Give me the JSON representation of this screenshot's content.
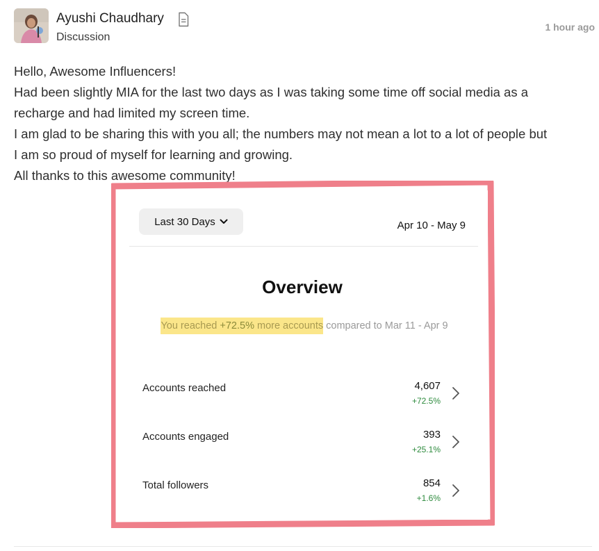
{
  "post": {
    "author": "Ayushi Chaudhary",
    "category": "Discussion",
    "timestamp": "1 hour ago",
    "body_lines": [
      "Hello, Awesome Influencers!",
      "Had been slightly MIA for the last two days as I was taking some time off social media as a",
      "recharge and had limited my screen time.",
      "I am glad to be sharing this with you all; the numbers may not mean a lot to a lot of people but",
      "I am so proud of myself for learning and growing.",
      "All thanks to this awesome community!"
    ]
  },
  "screenshot": {
    "range_button": "Last 30 Days",
    "date_range": "Apr 10 - May 9",
    "title": "Overview",
    "note_highlight_before": "You reached ",
    "note_highlight_value": "+72.5%",
    "note_highlight_after": " more accounts",
    "note_rest": " compared to Mar 11 - Apr 9",
    "metrics": [
      {
        "label": "Accounts reached",
        "value": "4,607",
        "delta": "+72.5%"
      },
      {
        "label": "Accounts engaged",
        "value": "393",
        "delta": "+25.1%"
      },
      {
        "label": "Total followers",
        "value": "854",
        "delta": "+1.6%"
      }
    ]
  },
  "colors": {
    "frame_red": "#ef7f8a",
    "highlight_yellow": "#fbe68a",
    "delta_green": "#2e8b3e"
  },
  "icons": {
    "document": "document-icon",
    "chevron_down": "chevron-down-icon",
    "chevron_right": "chevron-right-icon"
  }
}
